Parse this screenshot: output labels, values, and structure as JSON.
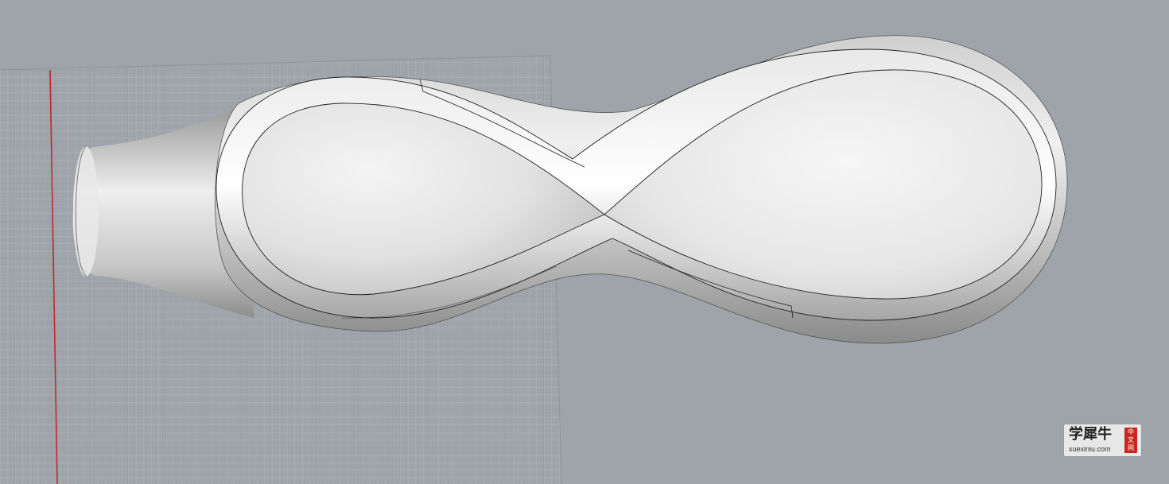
{
  "viewport": {
    "background_color": "#9fa4ab",
    "grid_line_color": "#b3b8bf",
    "grid_major_color": "#8c9199",
    "axis_color": "#c2282b",
    "model_highlight": "#f2f2f2",
    "model_shadow": "#8c8c8c",
    "outline_color": "#202020"
  },
  "watermark": {
    "title": "学犀牛",
    "url": "xuexiniu.com",
    "seal": [
      "中",
      "文",
      "网"
    ]
  }
}
